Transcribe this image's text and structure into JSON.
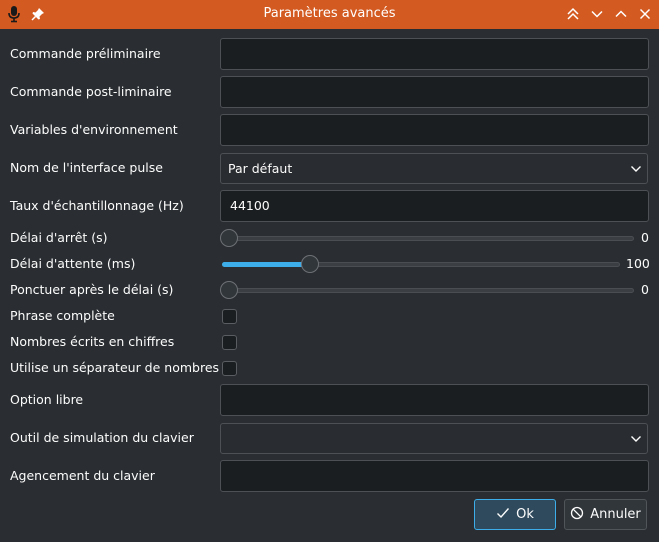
{
  "window": {
    "title": "Paramètres avancés"
  },
  "labels": {
    "pre_command": "Commande préliminaire",
    "post_command": "Commande post-liminaire",
    "env_vars": "Variables d'environnement",
    "pulse_interface": "Nom de l'interface pulse",
    "sample_rate": "Taux d'échantillonnage (Hz)",
    "stop_delay": "Délai d'arrêt (s)",
    "wait_delay": "Délai d'attente (ms)",
    "punctuate_delay": "Ponctuer après le délai (s)",
    "full_sentence": "Phrase complète",
    "numbers_digits": "Nombres écrits en chiffres",
    "number_separator": "Utilise un séparateur de nombres",
    "free_option": "Option libre",
    "keyboard_tool": "Outil de simulation du clavier",
    "keyboard_layout": "Agencement du clavier"
  },
  "values": {
    "pre_command": "",
    "post_command": "",
    "env_vars": "",
    "pulse_interface": "Par défaut",
    "sample_rate": "44100",
    "stop_delay": "0",
    "wait_delay": "100",
    "punctuate_delay": "0",
    "full_sentence": false,
    "numbers_digits": false,
    "number_separator": false,
    "free_option": "",
    "keyboard_tool": "",
    "keyboard_layout": ""
  },
  "sliders": {
    "stop_delay_fraction": 0,
    "wait_delay_fraction": 0.21,
    "punctuate_delay_fraction": 0
  },
  "buttons": {
    "ok": "Ok",
    "cancel": "Annuler"
  },
  "icons": {
    "app": "microphone-icon",
    "pin": "pin-icon",
    "keep_above": "double-chevron-up-icon",
    "minimize": "chevron-down-icon",
    "maximize": "chevron-up-icon",
    "close": "close-icon"
  },
  "colors": {
    "titlebar": "#d35a20",
    "background": "#2a2e32",
    "accent": "#3daee9"
  }
}
